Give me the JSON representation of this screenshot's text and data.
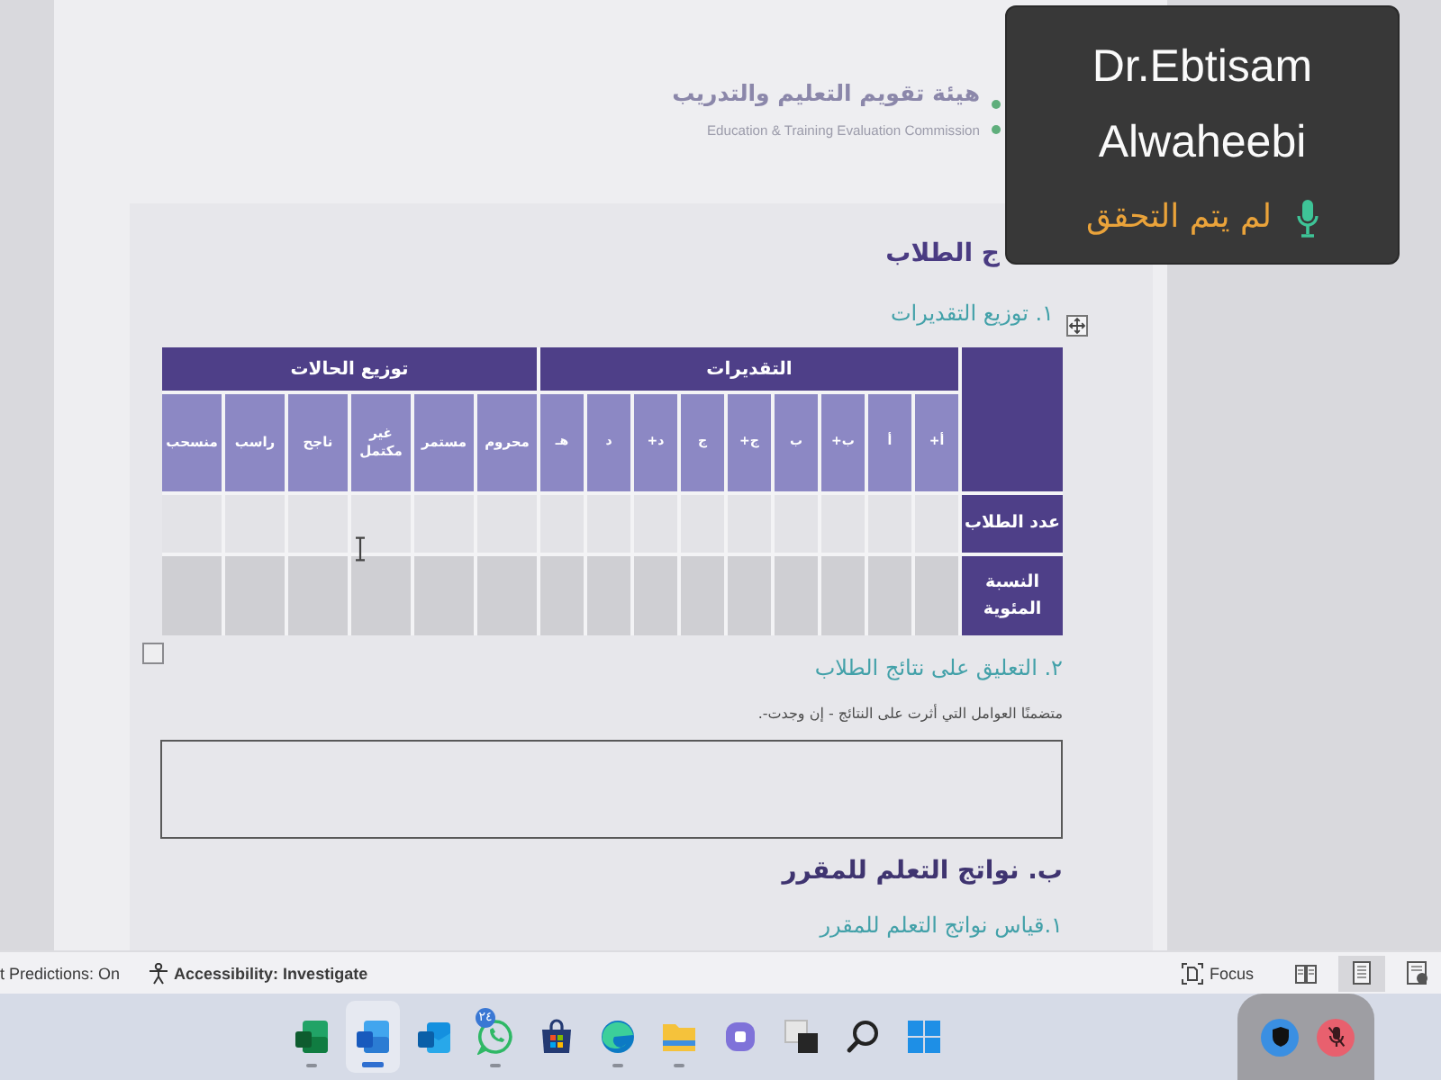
{
  "logo": {
    "arabic_name": "هيئة تقويم التعليم والتدريب",
    "english_name": "Education & Training Evaluation Commission"
  },
  "document": {
    "section_heading": "ج الطلاب",
    "grades_heading": "١. توزيع التقديرات",
    "table": {
      "groups": [
        {
          "label": "التقديرات",
          "columns": [
            "أ+",
            "أ",
            "ب+",
            "ب",
            "ج+",
            "ج",
            "د+",
            "د",
            "هـ"
          ]
        },
        {
          "label": "توزيع الحالات",
          "columns": [
            "محروم",
            "مستمر",
            "غير مكتمل",
            "ناجح",
            "راسب",
            "منسحب"
          ]
        }
      ],
      "rows": [
        "عدد الطلاب",
        "النسبة المئوية"
      ]
    },
    "comment_heading": "٢. التعليق على نتائج الطلاب",
    "comment_note": "متضمنًا العوامل التي أثرت على النتائج - إن وجدت-.",
    "outcomes_heading": "ب. نواتج التعلم للمقرر",
    "outcomes_subheading": "١.قياس نواتج التعلم للمقرر"
  },
  "video_tile": {
    "name_lines": [
      "Dr.Ebtisam",
      "Alwaheebi"
    ],
    "status": "لم يتم التحقق"
  },
  "status_bar": {
    "predictions": "t Predictions: On",
    "accessibility": "Accessibility: Investigate",
    "focus": "Focus",
    "views": [
      {
        "kind": "read",
        "selected": false
      },
      {
        "kind": "print",
        "selected": true
      },
      {
        "kind": "web",
        "selected": false
      }
    ]
  },
  "taskbar": {
    "apps": [
      {
        "kind": "spreadsheet",
        "selected": false,
        "running": true
      },
      {
        "kind": "document",
        "selected": true,
        "running": true
      },
      {
        "kind": "mail",
        "selected": false,
        "running": false
      },
      {
        "kind": "chat",
        "selected": false,
        "running": true,
        "badge": "٢٤"
      },
      {
        "kind": "store",
        "selected": false,
        "running": false
      },
      {
        "kind": "browser",
        "selected": false,
        "running": true
      },
      {
        "kind": "folder",
        "selected": false,
        "running": true
      },
      {
        "kind": "video_chat",
        "selected": false,
        "running": false
      },
      {
        "kind": "squares",
        "selected": false,
        "running": false
      },
      {
        "kind": "search",
        "selected": false,
        "running": false
      },
      {
        "kind": "start",
        "selected": false,
        "running": false
      }
    ]
  },
  "call_controls": [
    {
      "kind": "shield"
    },
    {
      "kind": "mic_off"
    }
  ]
}
